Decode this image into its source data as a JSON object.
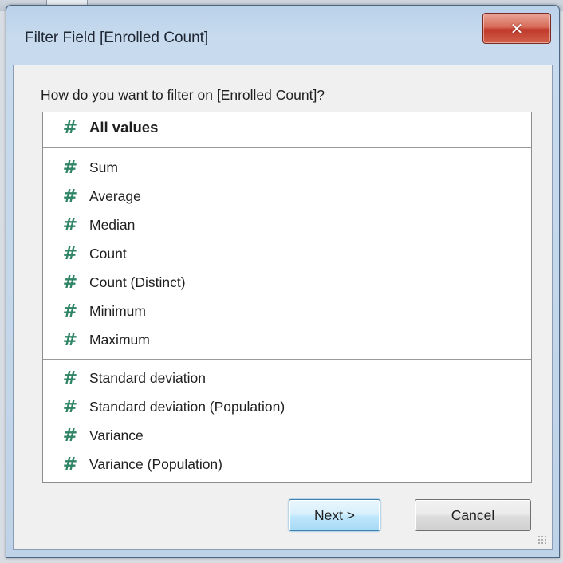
{
  "window": {
    "title": "Filter Field [Enrolled Count]",
    "close_label": "✕"
  },
  "prompt": "How do you want to filter on [Enrolled Count]?",
  "list": {
    "icon_glyph": "#",
    "icon_name": "hash-icon",
    "icon_color": "#2f8565",
    "selected": "All values",
    "groups": [
      [
        "All values"
      ],
      [
        "Sum",
        "Average",
        "Median",
        "Count",
        "Count (Distinct)",
        "Minimum",
        "Maximum"
      ],
      [
        "Standard deviation",
        "Standard deviation (Population)",
        "Variance",
        "Variance (Population)"
      ]
    ],
    "items": [
      {
        "label": "All values"
      },
      {
        "label": "Sum"
      },
      {
        "label": "Average"
      },
      {
        "label": "Median"
      },
      {
        "label": "Count"
      },
      {
        "label": "Count (Distinct)"
      },
      {
        "label": "Minimum"
      },
      {
        "label": "Maximum"
      },
      {
        "label": "Standard deviation"
      },
      {
        "label": "Standard deviation (Population)"
      },
      {
        "label": "Variance"
      },
      {
        "label": "Variance (Population)"
      }
    ]
  },
  "buttons": {
    "next_label": "Next >",
    "cancel_label": "Cancel"
  }
}
